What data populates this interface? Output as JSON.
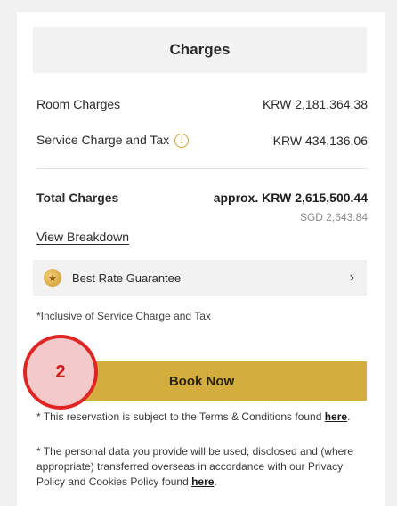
{
  "charges": {
    "title": "Charges",
    "room_label": "Room Charges",
    "room_value": "KRW 2,181,364.38",
    "service_label": "Service Charge and Tax",
    "service_value": "KRW 434,136.06",
    "total_label": "Total Charges",
    "total_value": "approx. KRW 2,615,500.44",
    "total_sgd": "SGD 2,643.84",
    "view_breakdown": "View Breakdown"
  },
  "guarantee": {
    "label": "Best Rate Guarantee",
    "icon": "medal-icon"
  },
  "note": "*Inclusive of Service Charge and Tax",
  "book": {
    "label": "Book Now"
  },
  "badge": {
    "number": "2"
  },
  "terms": {
    "line1_prefix": "* This reservation is subject to the Terms & Conditions found ",
    "line1_link": "here",
    "line1_suffix": ".",
    "line2_prefix": "* The personal data you provide will be used, disclosed and (where appropriate) transferred overseas in accordance with our Privacy Policy and Cookies Policy found ",
    "line2_link": "here",
    "line2_suffix": "."
  },
  "colors": {
    "accent_gold": "#d4ad3f",
    "badge_red": "#e02525"
  }
}
